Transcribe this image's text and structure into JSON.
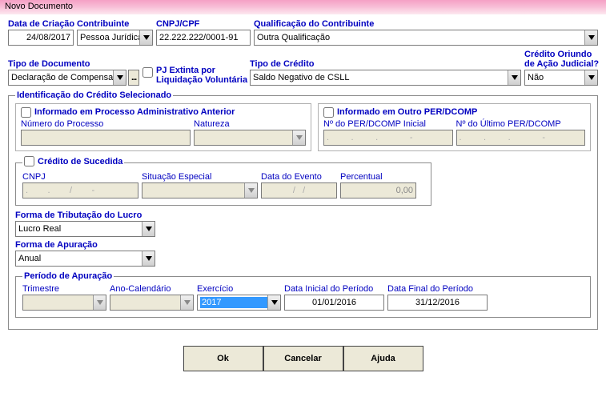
{
  "window": {
    "title": "Novo Documento"
  },
  "row1": {
    "data_criacao": {
      "label": "Data de Criação",
      "value": "24/08/2017"
    },
    "contribuinte": {
      "label": "Contribuinte",
      "value": "Pessoa Jurídica"
    },
    "cnpj_cpf": {
      "label": "CNPJ/CPF",
      "value": "22.222.222/0001-91"
    },
    "qualificacao": {
      "label": "Qualificação do Contribuinte",
      "value": "Outra Qualificação"
    }
  },
  "row2": {
    "tipo_doc": {
      "label": "Tipo de Documento",
      "value": "Declaração de Compensa"
    },
    "pj_extinta": {
      "label1": "PJ Extinta por",
      "label2": "Liquidação Voluntária"
    },
    "side_btn_icon": "options-icon",
    "tipo_credito": {
      "label": "Tipo de Crédito",
      "value": "Saldo Negativo de CSLL"
    },
    "credito_judicial": {
      "label1": "Crédito Oriundo",
      "label2": "de Ação Judicial?",
      "value": "Não"
    }
  },
  "ident": {
    "legend": "Identificação do Crédito Selecionado",
    "proc_admin": {
      "header": "Informado em Processo Administrativo Anterior",
      "numero_label": "Número do Processo",
      "natureza_label": "Natureza"
    },
    "outro_perdcomp": {
      "header": "Informado em Outro PER/DCOMP",
      "inicial_label": "Nº do PER/DCOMP Inicial",
      "ultimo_label": "Nº do Último PER/DCOMP",
      "dots": ".         .         .             -"
    },
    "sucedida": {
      "legend": "Crédito de Sucedida",
      "cnpj_label": "CNPJ",
      "cnpj_value": ".        .        /        -",
      "situacao_label": "Situação Especial",
      "data_evento_label": "Data do Evento",
      "data_evento_value": "/   /",
      "percentual_label": "Percentual",
      "percentual_value": "0,00"
    },
    "forma_trib": {
      "label": "Forma de Tributação do Lucro",
      "value": "Lucro Real"
    },
    "forma_apur": {
      "label": "Forma de Apuração",
      "value": "Anual"
    },
    "periodo": {
      "legend": "Período de Apuração",
      "trimestre_label": "Trimestre",
      "ano_label": "Ano-Calendário",
      "exercicio_label": "Exercício",
      "exercicio_value": "2017",
      "data_inicial_label": "Data Inicial do Período",
      "data_inicial_value": "01/01/2016",
      "data_final_label": "Data Final do Período",
      "data_final_value": "31/12/2016"
    }
  },
  "buttons": {
    "ok": "Ok",
    "cancel": "Cancelar",
    "help": "Ajuda"
  }
}
